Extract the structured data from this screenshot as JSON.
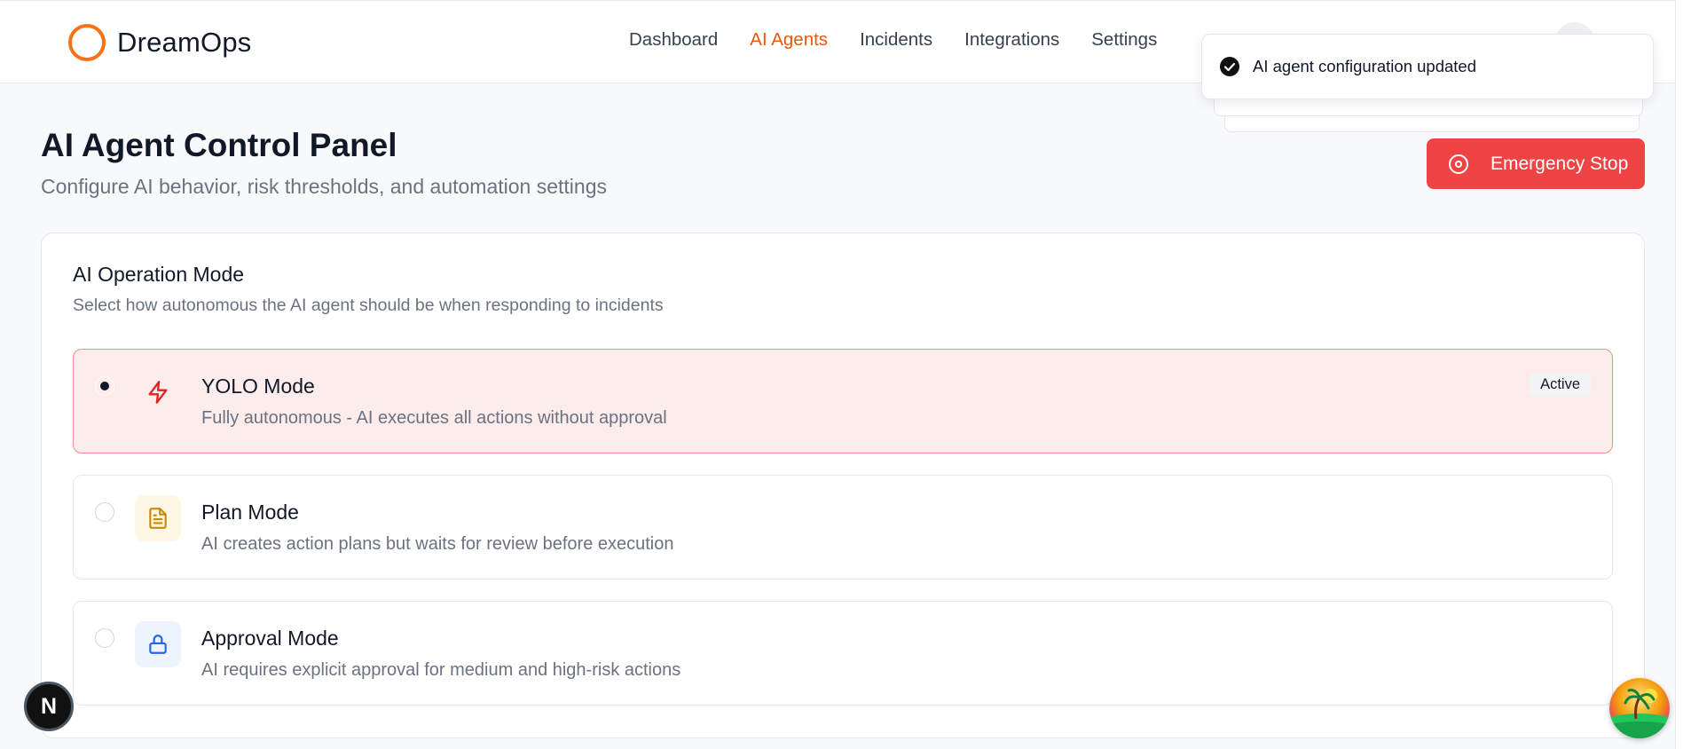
{
  "brand": {
    "name": "DreamOps",
    "accent": "#f97316"
  },
  "nav": {
    "items": [
      {
        "label": "Dashboard",
        "active": false
      },
      {
        "label": "AI Agents",
        "active": true
      },
      {
        "label": "Incidents",
        "active": false
      },
      {
        "label": "Integrations",
        "active": false
      },
      {
        "label": "Settings",
        "active": false
      }
    ]
  },
  "page": {
    "title": "AI Agent Control Panel",
    "subtitle": "Configure AI behavior, risk thresholds, and automation settings"
  },
  "emergency_stop": {
    "label": "Emergency Stop",
    "icon": "stop-circle-icon",
    "color": "#ef4444"
  },
  "operation_mode": {
    "title": "AI Operation Mode",
    "description": "Select how autonomous the AI agent should be when responding to incidents",
    "modes": [
      {
        "title": "YOLO Mode",
        "description": "Fully autonomous - AI executes all actions without approval",
        "icon": "lightning-icon",
        "selected": true,
        "badge": "Active"
      },
      {
        "title": "Plan Mode",
        "description": "AI creates action plans but waits for review before execution",
        "icon": "document-icon",
        "selected": false
      },
      {
        "title": "Approval Mode",
        "description": "AI requires explicit approval for medium and high-risk actions",
        "icon": "lock-icon",
        "selected": false
      }
    ]
  },
  "toast": {
    "message": "AI agent configuration updated",
    "icon": "check-circle-icon"
  },
  "floating": {
    "dev_button": "N",
    "assistant_icon": "beach-island-icon"
  }
}
